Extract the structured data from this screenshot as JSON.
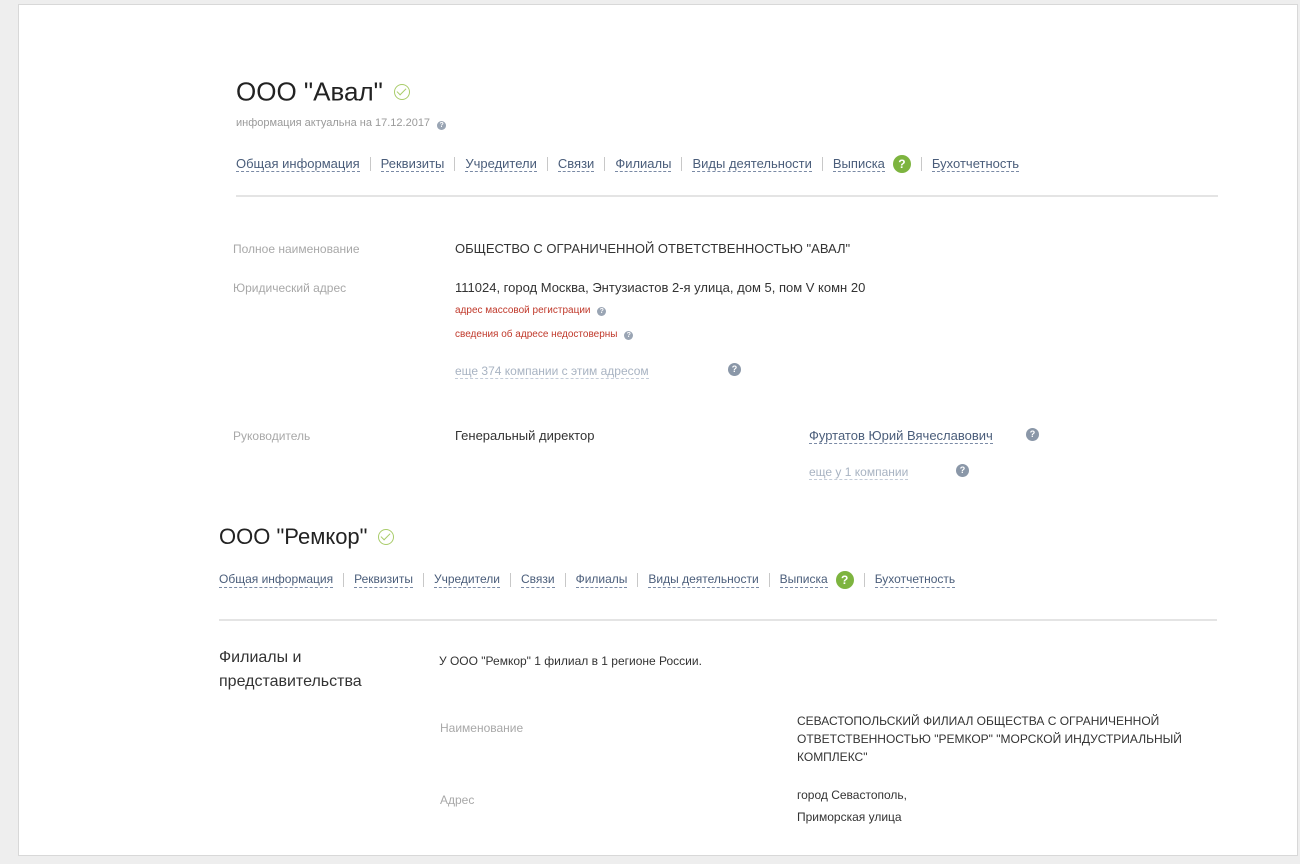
{
  "company1": {
    "name": "ООО \"Авал\"",
    "actual": "информация актуальна на 17.12.2017",
    "tabs": [
      "Общая информация",
      "Реквизиты",
      "Учредители",
      "Связи",
      "Филиалы",
      "Виды деятельности",
      "Выписка",
      "Бухотчетность"
    ],
    "full_name_label": "Полное наименование",
    "full_name": "ОБЩЕСТВО С ОГРАНИЧЕННОЙ ОТВЕТСТВЕННОСТЬЮ \"АВАЛ\"",
    "address_label": "Юридический адрес",
    "address": "111024, город Москва, Энтузиастов 2-я улица, дом 5, пом V комн 20",
    "warning_mass": "адрес массовой регистрации",
    "warning_unreliable": "сведения об адресе недостоверны",
    "address_more": "еще 374 компании с этим адресом",
    "head_label": "Руководитель",
    "head_position": "Генеральный директор",
    "head_name": "Фуртатов Юрий Вячеславович",
    "head_more": "еще у 1 компании"
  },
  "company2": {
    "name": "ООО \"Ремкор\"",
    "tabs": [
      "Общая информация",
      "Реквизиты",
      "Учредители",
      "Связи",
      "Филиалы",
      "Виды деятельности",
      "Выписка",
      "Бухотчетность"
    ],
    "branches_heading": "Филиалы и представительства",
    "branches_summary": "У ООО \"Ремкор\" 1 филиал в 1 регионе России.",
    "name_label": "Наименование",
    "branch_name": "СЕВАСТОПОЛЬСКИЙ ФИЛИАЛ ОБЩЕСТВА С ОГРАНИЧЕННОЙ ОТВЕТСТВЕННОСТЬЮ \"РЕМКОР\" \"МОРСКОЙ ИНДУСТРИАЛЬНЫЙ КОМПЛЕКС\"",
    "address_label": "Адрес",
    "branch_address_line1": "город Севастополь,",
    "branch_address_line2": "Приморская улица"
  },
  "icons": {
    "check": "check-circle-icon",
    "question": "question-icon"
  },
  "colors": {
    "accent_green": "#7db43f",
    "link": "#4a5d7a",
    "warning": "#c0392b"
  }
}
